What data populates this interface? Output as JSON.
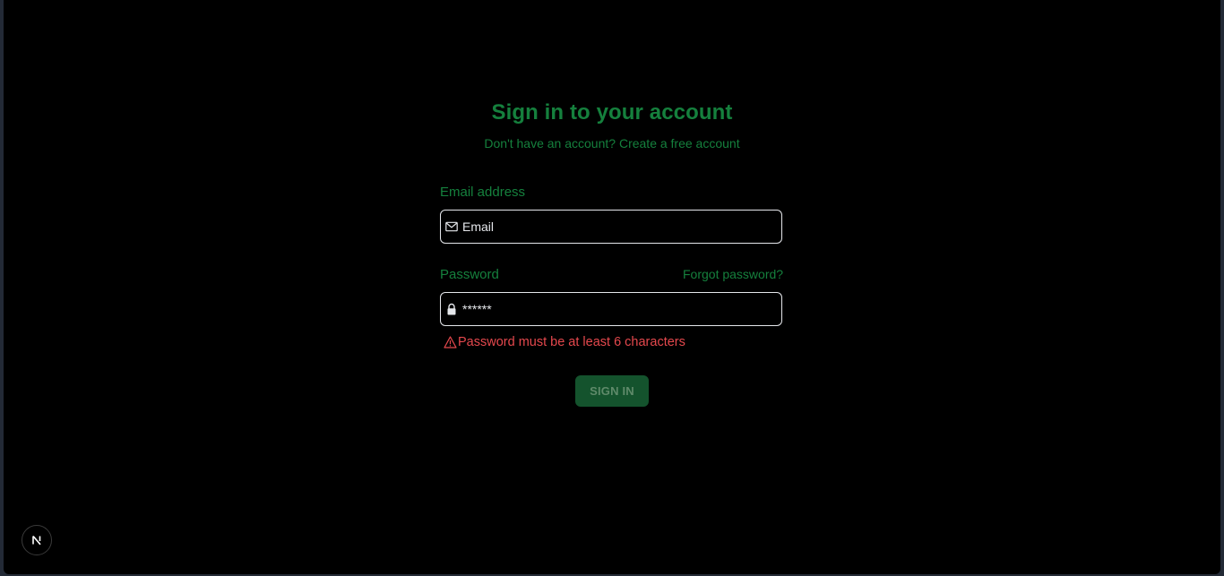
{
  "header": {
    "title": "Sign in to your account",
    "subtitle_prefix": "Don't have an account?",
    "create_account_link": "Create a free account"
  },
  "form": {
    "email_label": "Email address",
    "email_placeholder": "Email",
    "email_value": "",
    "password_label": "Password",
    "forgot_password_link": "Forgot password?",
    "password_value": "******",
    "error_message": "Password must be at least 6 characters",
    "submit_label": "SIGN IN"
  },
  "icons": {
    "email": "mail-icon",
    "password": "lock-icon",
    "error": "warning-icon",
    "devtools": "nextjs-logo-icon"
  },
  "colors": {
    "accent": "#15803d",
    "button_bg": "#14532d",
    "error": "#e5484d",
    "background": "#000000"
  }
}
